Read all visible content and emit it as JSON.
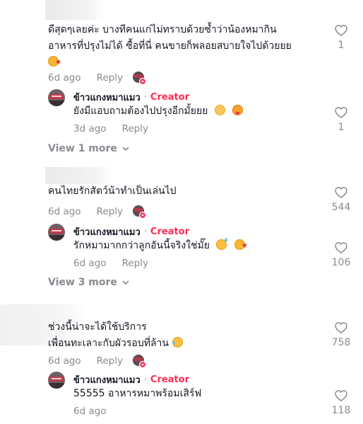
{
  "icons": {
    "like": "heart-outline-icon",
    "expand": "chevron-down-icon"
  },
  "colors": {
    "creator_tag": "#fe2c55",
    "meta_text": "#8a8b91",
    "text": "#161823"
  },
  "comments": [
    {
      "text_line1": "ดีสุดๆเลยค่ะ บางทีคนแก่ไม่ทราบด้วยซ้ำว่าน้องหมากิน",
      "text_line2": "อาหารที่ปรุงไม่ได้ ซื้อที่นี่ คนขายก็พลอยสบายใจไปด้วยยย",
      "time": "6d ago",
      "reply": "Reply",
      "likes": "1",
      "creator_reply": {
        "name": "ข้าวแกงหมาแมว",
        "separator": "·",
        "tag": "Creator",
        "text": "ยังมีแอบถามต้องไปปรุงอีกมั้ยยย",
        "time": "3d ago",
        "reply": "Reply",
        "likes": "1"
      },
      "view_more": "View 1 more"
    },
    {
      "text_line1": "คนไทยรักสัตว์น้าทำเป็นเล่นไป",
      "time": "6d ago",
      "reply": "Reply",
      "likes": "544",
      "creator_reply": {
        "name": "ข้าวแกงหมาแมว",
        "separator": "·",
        "tag": "Creator",
        "text": "รักหมามากกว่าลูกอันนี้จริงใช่มั๊ย",
        "time": "6d ago",
        "reply": "Reply",
        "likes": "106"
      },
      "view_more": "View 3 more"
    },
    {
      "text_line1": "ช่วงนี้น่าจะได้ใช้บริการ",
      "text_line2": "เพื่อนทะเลาะกับผัวรอบที่ล้าน",
      "time": "6d ago",
      "reply": "Reply",
      "likes": "758",
      "creator_reply": {
        "name": "ข้าวแกงหมาแมว",
        "separator": "·",
        "tag": "Creator",
        "text": "55555 อาหารหมาพร้อมเสิร์ฟ",
        "time": "6d ago",
        "likes": "118"
      }
    }
  ]
}
